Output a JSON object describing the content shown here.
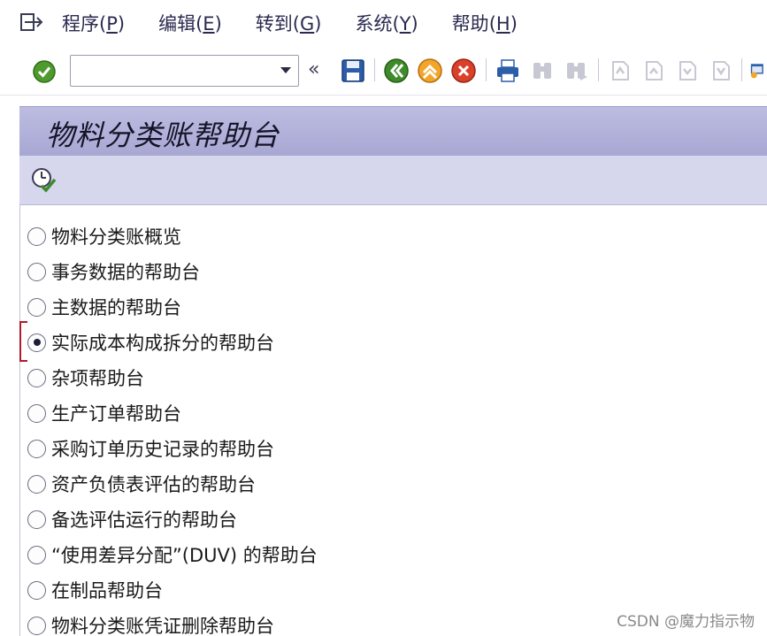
{
  "menu": {
    "items": [
      {
        "text": "程序",
        "key": "P"
      },
      {
        "text": "编辑",
        "key": "E"
      },
      {
        "text": "转到",
        "key": "G"
      },
      {
        "text": "系统",
        "key": "Y"
      },
      {
        "text": "帮助",
        "key": "H"
      }
    ]
  },
  "toolbar": {
    "command_value": "",
    "icons": [
      "enter-icon",
      "save-icon",
      "back-icon",
      "exit-icon",
      "cancel-icon",
      "print-icon",
      "find-icon",
      "find-next-icon",
      "first-page-icon",
      "previous-page-icon",
      "next-page-icon",
      "last-page-icon",
      "create-session-icon"
    ],
    "chevron": "«"
  },
  "title": "物料分类账帮助台",
  "app_toolbar": {
    "icons": [
      "execute-icon"
    ]
  },
  "options": [
    {
      "label": "物料分类账概览",
      "selected": false
    },
    {
      "label": "事务数据的帮助台",
      "selected": false
    },
    {
      "label": "主数据的帮助台",
      "selected": false
    },
    {
      "label": "实际成本构成拆分的帮助台",
      "selected": true
    },
    {
      "label": "杂项帮助台",
      "selected": false
    },
    {
      "label": "生产订单帮助台",
      "selected": false
    },
    {
      "label": "采购订单历史记录的帮助台",
      "selected": false
    },
    {
      "label": "资产负债表评估的帮助台",
      "selected": false
    },
    {
      "label": "备选评估运行的帮助台",
      "selected": false
    },
    {
      "label": "“使用差异分配”(DUV) 的帮助台",
      "selected": false
    },
    {
      "label": "在制品帮助台",
      "selected": false
    },
    {
      "label": "物料分类账凭证删除帮助台",
      "selected": false
    }
  ],
  "watermark": "CSDN @魔力指示物"
}
